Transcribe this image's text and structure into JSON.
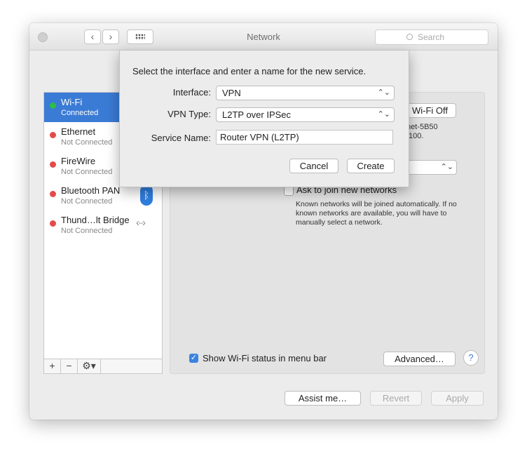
{
  "window": {
    "title": "Network",
    "search_placeholder": "Search"
  },
  "sidebar": {
    "services": [
      {
        "name": "Wi-Fi",
        "status": "Connected",
        "color": "#2bbf48",
        "selected": true
      },
      {
        "name": "Ethernet",
        "status": "Not Connected",
        "color": "#e34b4b"
      },
      {
        "name": "FireWire",
        "status": "Not Connected",
        "color": "#e34b4b"
      },
      {
        "name": "Bluetooth PAN",
        "status": "Not Connected",
        "color": "#e34b4b",
        "icon": "bluetooth-icon"
      },
      {
        "name": "Thund…lt Bridge",
        "status": "Not Connected",
        "color": "#e34b4b",
        "icon": "bridge-arrows-icon"
      }
    ],
    "toolbar": {
      "add": "+",
      "remove": "−",
      "action": "⚙▾"
    }
  },
  "pane": {
    "wifi_off_label": "Wi-Fi Off",
    "network_text_1": "net-5B50",
    "network_text_2": ".100.",
    "ask_label": "Ask to join new networks",
    "ask_description": "Known networks will be joined automatically. If no known networks are available, you will have to manually select a network.",
    "show_status_label": "Show Wi-Fi status in menu bar",
    "advanced_label": "Advanced…",
    "help_label": "?"
  },
  "footer": {
    "assist_label": "Assist me…",
    "revert_label": "Revert",
    "apply_label": "Apply"
  },
  "sheet": {
    "prompt": "Select the interface and enter a name for the new service.",
    "interface_label": "Interface:",
    "interface_value": "VPN",
    "vpn_type_label": "VPN Type:",
    "vpn_type_value": "L2TP over IPSec",
    "service_name_label": "Service Name:",
    "service_name_value": "Router VPN (L2TP)",
    "cancel_label": "Cancel",
    "create_label": "Create"
  },
  "colors": {
    "accent": "#3a7bd5",
    "connected": "#2bbf48",
    "disconnected": "#e34b4b"
  }
}
